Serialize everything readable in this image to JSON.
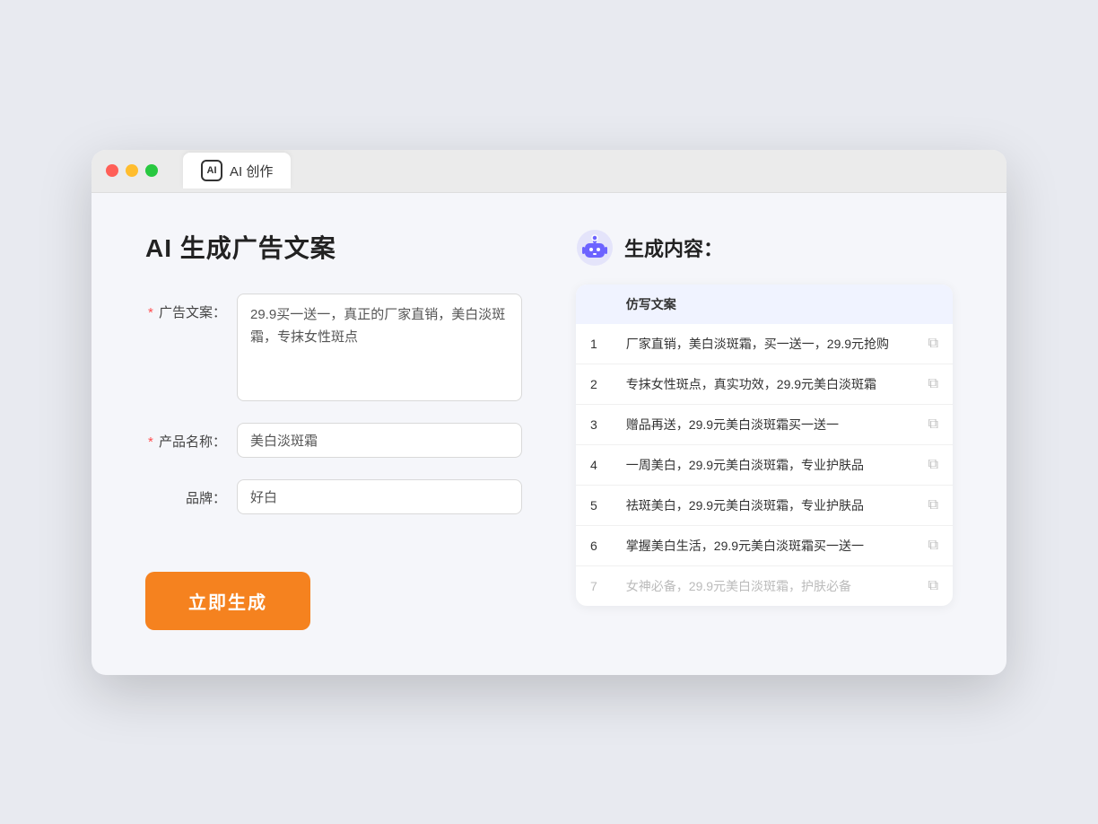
{
  "window": {
    "tab_label": "AI 创作",
    "tab_icon_text": "AI"
  },
  "left": {
    "page_title": "AI 生成广告文案",
    "fields": [
      {
        "label": "广告文案：",
        "required": true,
        "type": "textarea",
        "value": "29.9买一送一，真正的厂家直销，美白淡斑霜，专抹女性斑点",
        "name": "ad-copy-input"
      },
      {
        "label": "产品名称：",
        "required": true,
        "type": "input",
        "value": "美白淡斑霜",
        "name": "product-name-input"
      },
      {
        "label": "品牌：",
        "required": false,
        "type": "input",
        "value": "好白",
        "name": "brand-input"
      }
    ],
    "button_label": "立即生成"
  },
  "right": {
    "title": "生成内容：",
    "column_header": "仿写文案",
    "results": [
      {
        "num": "1",
        "text": "厂家直销，美白淡斑霜，买一送一，29.9元抢购",
        "dimmed": false
      },
      {
        "num": "2",
        "text": "专抹女性斑点，真实功效，29.9元美白淡斑霜",
        "dimmed": false
      },
      {
        "num": "3",
        "text": "赠品再送，29.9元美白淡斑霜买一送一",
        "dimmed": false
      },
      {
        "num": "4",
        "text": "一周美白，29.9元美白淡斑霜，专业护肤品",
        "dimmed": false
      },
      {
        "num": "5",
        "text": "祛斑美白，29.9元美白淡斑霜，专业护肤品",
        "dimmed": false
      },
      {
        "num": "6",
        "text": "掌握美白生活，29.9元美白淡斑霜买一送一",
        "dimmed": false
      },
      {
        "num": "7",
        "text": "女神必备，29.9元美白淡斑霜，护肤必备",
        "dimmed": true
      }
    ]
  }
}
